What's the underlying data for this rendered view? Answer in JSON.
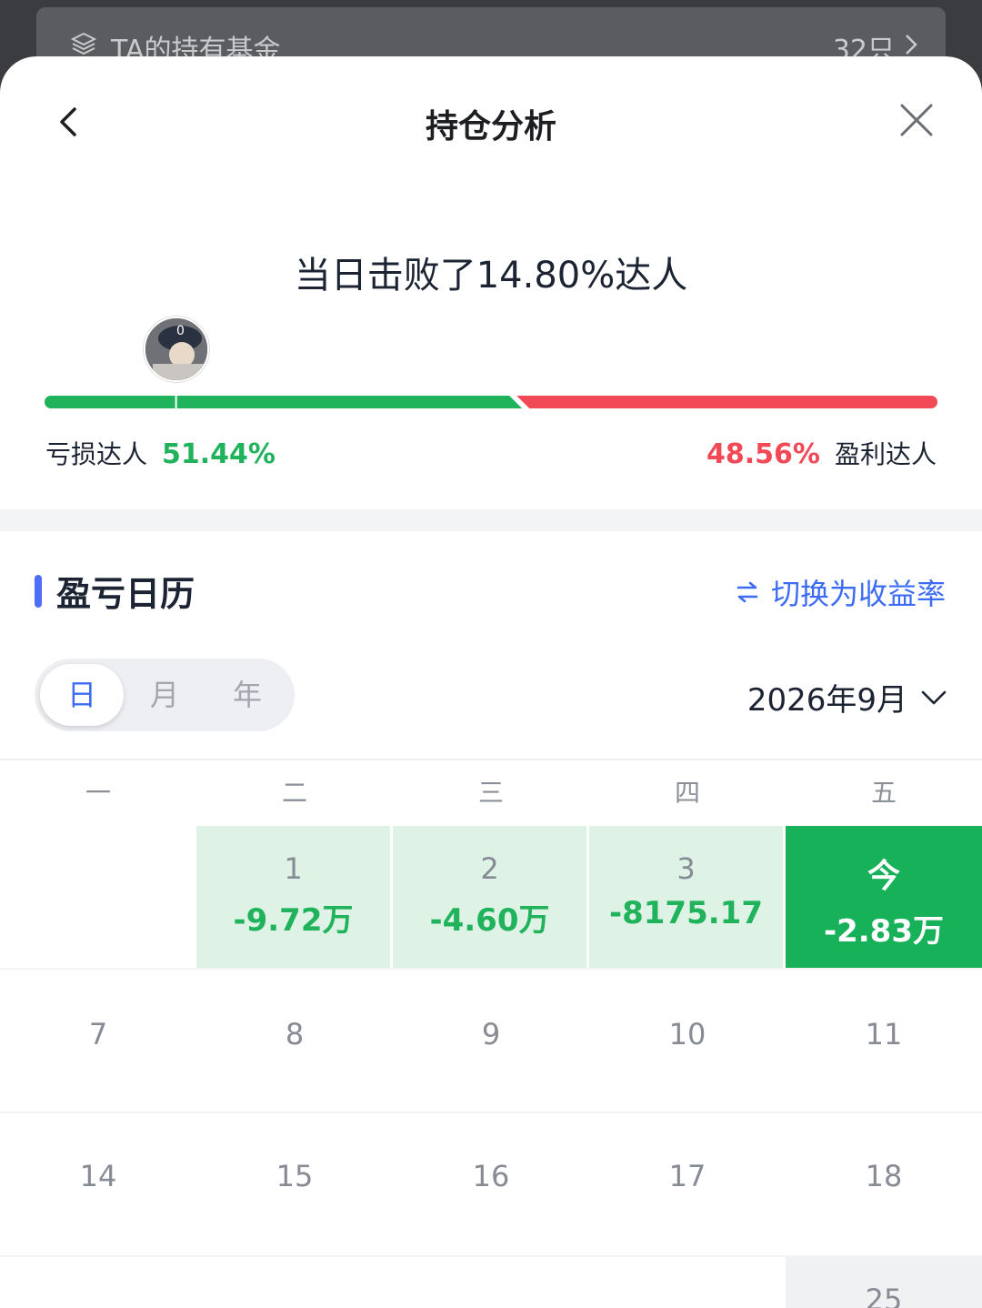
{
  "background": {
    "title": "TA的持有基金",
    "count": "32只"
  },
  "header": {
    "title": "持仓分析"
  },
  "rank": {
    "headline": "当日击败了14.80%达人",
    "loss_label": "亏损达人",
    "loss_value": "51.44%",
    "gain_value": "48.56%",
    "gain_label": "盈利达人",
    "loss_fraction": 0.5144,
    "user_position_fraction": 0.148,
    "colors": {
      "loss": "#20b35c",
      "gain": "#f24957"
    }
  },
  "calendar": {
    "section_title": "盈亏日历",
    "switch_label": "切换为收益率",
    "tabs": [
      {
        "label": "日",
        "active": true
      },
      {
        "label": "月",
        "active": false
      },
      {
        "label": "年",
        "active": false
      }
    ],
    "month": "2026年9月",
    "weekdays": [
      "一",
      "二",
      "三",
      "四",
      "五"
    ],
    "rows": [
      [
        {
          "day": "",
          "value": ""
        },
        {
          "day": "1",
          "value": "-9.72万",
          "state": "loss"
        },
        {
          "day": "2",
          "value": "-4.60万",
          "state": "loss"
        },
        {
          "day": "3",
          "value": "-8175.17",
          "state": "loss"
        },
        {
          "day": "今",
          "value": "-2.83万",
          "state": "today"
        }
      ],
      [
        {
          "day": "7"
        },
        {
          "day": "8"
        },
        {
          "day": "9"
        },
        {
          "day": "10"
        },
        {
          "day": "11"
        }
      ],
      [
        {
          "day": "14"
        },
        {
          "day": "15"
        },
        {
          "day": "16"
        },
        {
          "day": "17"
        },
        {
          "day": "18"
        }
      ],
      [
        {
          "day": ""
        },
        {
          "day": ""
        },
        {
          "day": ""
        },
        {
          "day": ""
        },
        {
          "day": "25"
        }
      ]
    ]
  }
}
